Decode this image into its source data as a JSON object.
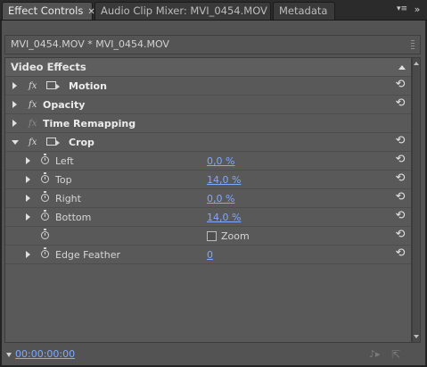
{
  "tabs": [
    {
      "label": "Effect Controls",
      "active": true,
      "closable": true
    },
    {
      "label": "Audio Clip Mixer: MVI_0454.MOV",
      "active": false
    },
    {
      "label": "Metadata",
      "active": false
    }
  ],
  "tab_menu_icon": "panel-menu-icon",
  "tab_close_glyph": "✕",
  "clip_label": "MVI_0454.MOV * MVI_0454.MOV",
  "section_header": "Video Effects",
  "effects": [
    {
      "name": "Motion",
      "expanded": false,
      "fx_enabled": true,
      "has_mask_icon": true
    },
    {
      "name": "Opacity",
      "expanded": false,
      "fx_enabled": true,
      "has_mask_icon": false
    },
    {
      "name": "Time Remapping",
      "expanded": false,
      "fx_enabled": false,
      "has_mask_icon": false
    },
    {
      "name": "Crop",
      "expanded": true,
      "fx_enabled": true,
      "has_mask_icon": true
    }
  ],
  "fx_glyph": "fx",
  "crop_params": [
    {
      "name": "Left",
      "value": "0,0 %"
    },
    {
      "name": "Top",
      "value": "14,0 %"
    },
    {
      "name": "Right",
      "value": "0,0 %"
    },
    {
      "name": "Bottom",
      "value": "14,0 %"
    },
    {
      "name": "",
      "checkbox_label": "Zoom",
      "checked": false
    },
    {
      "name": "Edge Feather",
      "value": "0"
    }
  ],
  "reset_glyph": "⟲",
  "timecode": "00:00:00:00",
  "colors": {
    "panel_bg": "#535353",
    "link_value": "#7fa8ff",
    "tab_active": "#535353",
    "tab_inactive": "#3a3a3a"
  }
}
